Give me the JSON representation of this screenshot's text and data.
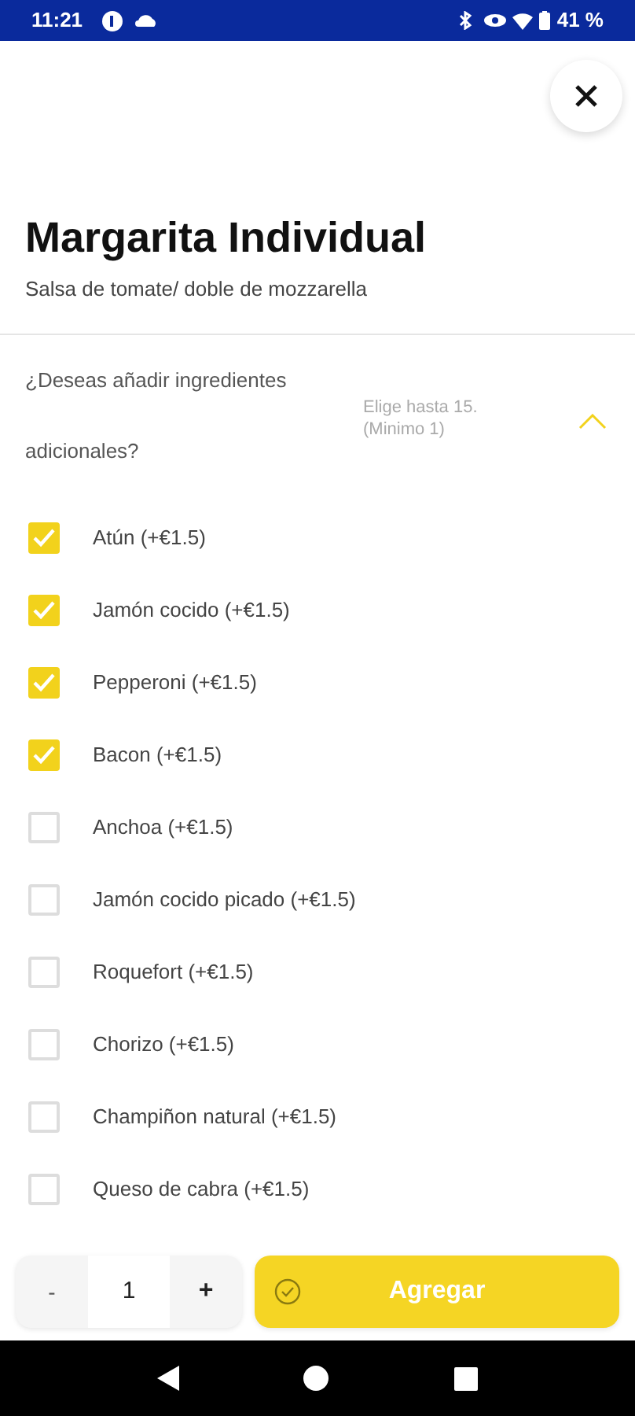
{
  "status_bar": {
    "time": "11:21",
    "battery": "41 %"
  },
  "product": {
    "title": "Margarita Individual",
    "description": "Salsa de tomate/ doble de mozzarella"
  },
  "section": {
    "question": "¿Deseas añadir ingredientes adicionales?",
    "hint_line_1": "Elige hasta 15.",
    "hint_line_2": "(Minimo 1)",
    "expanded": true
  },
  "options": [
    {
      "label": "Atún (+€1.5)",
      "checked": true
    },
    {
      "label": "Jamón cocido (+€1.5)",
      "checked": true
    },
    {
      "label": "Pepperoni (+€1.5)",
      "checked": true
    },
    {
      "label": "Bacon (+€1.5)",
      "checked": true
    },
    {
      "label": "Anchoa (+€1.5)",
      "checked": false
    },
    {
      "label": "Jamón cocido picado (+€1.5)",
      "checked": false
    },
    {
      "label": "Roquefort (+€1.5)",
      "checked": false
    },
    {
      "label": "Chorizo (+€1.5)",
      "checked": false
    },
    {
      "label": "Champiñon natural (+€1.5)",
      "checked": false
    },
    {
      "label": "Queso de cabra (+€1.5)",
      "checked": false
    }
  ],
  "order_bar": {
    "decrease": "-",
    "quantity": "1",
    "increase": "+",
    "add_button": "Agregar"
  }
}
